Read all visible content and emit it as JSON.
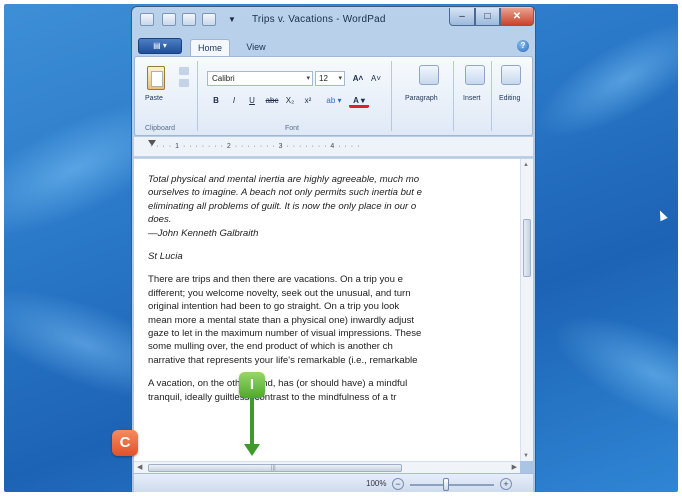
{
  "window": {
    "title": "Trips v. Vacations - WordPad",
    "minimize_glyph": "–",
    "maximize_glyph": "□",
    "close_glyph": "✕"
  },
  "ribbon": {
    "app_menu_glyph": "▤ ▾",
    "tabs": [
      {
        "label": "Home"
      },
      {
        "label": "View"
      }
    ],
    "help_glyph": "?",
    "clipboard": {
      "paste_label": "Paste",
      "group_label": "Clipboard"
    },
    "font": {
      "font_name": "Calibri",
      "font_size": "12",
      "dropdown_glyph": "▾",
      "grow_label": "A˄",
      "shrink_label": "A˅",
      "bold_label": "B",
      "italic_label": "I",
      "underline_label": "U",
      "strike_label": "abc",
      "subscript_label": "X₂",
      "superscript_label": "x²",
      "highlight_label": "ab ▾",
      "color_label": "A ▾",
      "group_label": "Font"
    },
    "paragraph_label": "Paragraph",
    "insert_label": "Insert",
    "editing_label": "Editing"
  },
  "ruler": {
    "ticks": "· · · · 1 · · · · · · · 2 · · · · · · · 3 · · · · · · · 4 · · · ·"
  },
  "document": {
    "quote_lines": [
      "Total physical and mental inertia are highly agreeable, much mo",
      "ourselves to imagine. A beach not only permits such inertia but e",
      "eliminating all problems of guilt. It is now the only place in our o",
      "does."
    ],
    "attribution": "—John Kenneth Galbraith",
    "place": "St Lucia",
    "paragraph1_lines": [
      "There are trips and then there are vacations. On a trip you e",
      "different; you welcome novelty, seek out the unusual, and turn",
      "original intention had been to go straight. On a trip you look",
      "mean more a mental state than a physical one) inwardly adjust",
      "gaze to let in the maximum number of visual impressions. These",
      "some mulling over, the end product of which is another ch",
      "narrative that represents your life's remarkable (i.e., remarkable"
    ],
    "paragraph2_lines": [
      "A vacation, on the other hand, has (or should have) a mindful",
      "tranquil, ideally guiltless, contrast to the mindfulness of a tr"
    ]
  },
  "statusbar": {
    "zoom": "100%",
    "zoom_out_glyph": "−",
    "zoom_in_glyph": "+"
  },
  "callouts": {
    "c_label": "C",
    "i_label": "I"
  },
  "colors": {
    "desktop_blue": "#2a78c8",
    "callout_c": "#e0522b",
    "callout_i": "#4fa82f"
  }
}
